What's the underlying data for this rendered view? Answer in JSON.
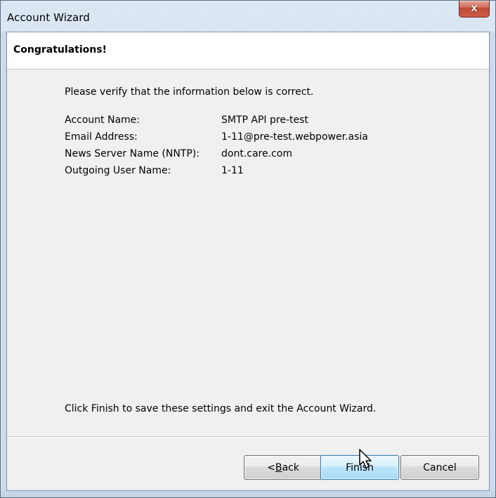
{
  "window": {
    "title": "Account Wizard",
    "close_glyph": "x",
    "close_icon": "close-icon"
  },
  "header": {
    "title": "Congratulations!"
  },
  "content": {
    "intro": "Please verify that the information below is correct.",
    "details": [
      {
        "label": "Account Name:",
        "value": "SMTP API pre-test"
      },
      {
        "label": "Email Address:",
        "value": "1-11@pre-test.webpower.asia"
      },
      {
        "label": "News Server Name (NNTP):",
        "value": "dont.care.com"
      },
      {
        "label": "Outgoing User Name:",
        "value": "1-11"
      }
    ],
    "footer_text": "Click Finish to save these settings and exit the Account Wizard."
  },
  "buttons": {
    "back": {
      "prefix": "< ",
      "mnemonic": "B",
      "rest": "ack"
    },
    "finish": {
      "label": "Finish"
    },
    "cancel": {
      "label": "Cancel"
    }
  },
  "cursor": {
    "icon": "mouse-pointer-icon"
  },
  "colors": {
    "frame_blue": "#c9d6e4",
    "close_red": "#cc5b45",
    "selected_button_blue": "#bee6fd"
  }
}
